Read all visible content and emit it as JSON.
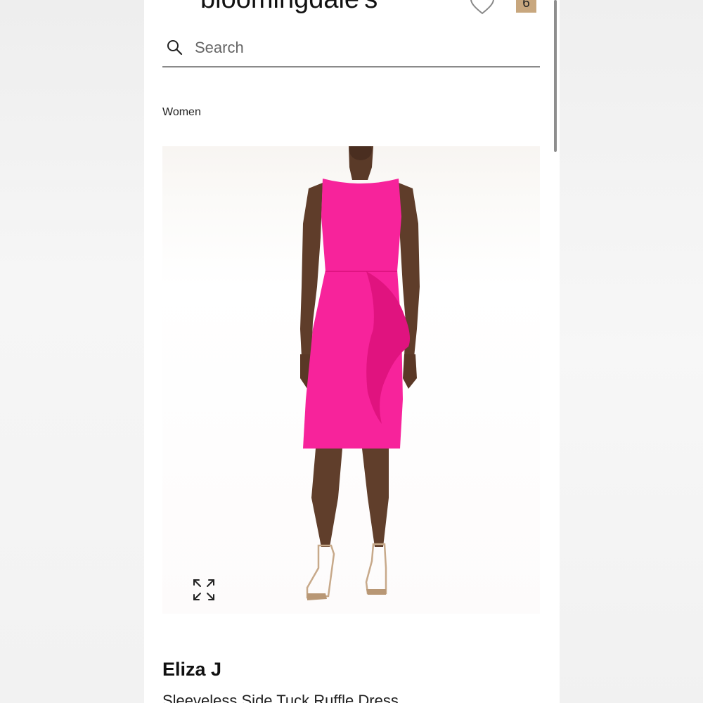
{
  "header": {
    "logo_text": "bloomingdale's",
    "menu_icon": "hamburger-menu-icon",
    "wishlist_icon": "heart-icon",
    "bag_count": "6"
  },
  "search": {
    "placeholder": "Search",
    "icon": "search-icon"
  },
  "breadcrumb": {
    "label": "Women"
  },
  "product": {
    "image_alt": "Model wearing pink sleeveless dress with side ruffle",
    "dress_color": "#f7239b",
    "expand_icon": "expand-arrows-icon",
    "brand": "Eliza J",
    "name": "Sleeveless Side Tuck Ruffle Dress"
  }
}
